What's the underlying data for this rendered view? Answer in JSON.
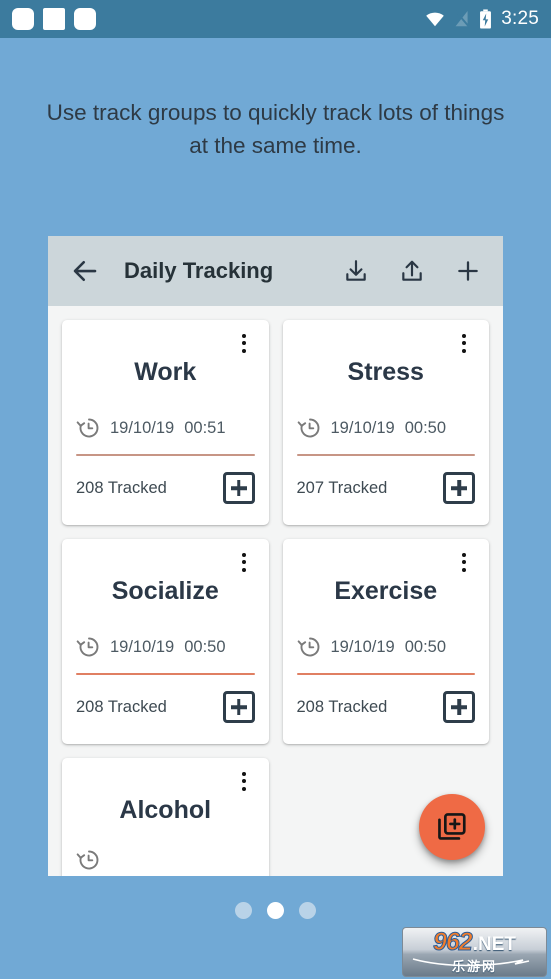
{
  "status_bar": {
    "time": "3:25",
    "icons": [
      "square-icon",
      "square-icon",
      "square-icon",
      "wifi-icon",
      "signal-off-icon",
      "battery-charging-icon"
    ]
  },
  "headline": "Use track groups to quickly track lots of things at the same time.",
  "app": {
    "title": "Daily Tracking",
    "back_icon": "arrow-back-icon",
    "actions": [
      {
        "name": "download-icon",
        "label": "Download"
      },
      {
        "name": "upload-icon",
        "label": "Upload"
      },
      {
        "name": "plus-icon",
        "label": "Add"
      }
    ],
    "fab": {
      "icon": "library-add-icon",
      "color": "#ef6a45"
    }
  },
  "cards": [
    {
      "title": "Work",
      "date": "19/10/19",
      "time": "00:51",
      "tracked": "208 Tracked",
      "divider_color": "#c79585",
      "menu_icon": "more-vert-icon",
      "history_icon": "history-icon",
      "add_icon": "add-box-icon"
    },
    {
      "title": "Stress",
      "date": "19/10/19",
      "time": "00:50",
      "tracked": "207 Tracked",
      "divider_color": "#c79585",
      "menu_icon": "more-vert-icon",
      "history_icon": "history-icon",
      "add_icon": "add-box-icon"
    },
    {
      "title": "Socialize",
      "date": "19/10/19",
      "time": "00:50",
      "tracked": "208 Tracked",
      "divider_color": "#e07f62",
      "menu_icon": "more-vert-icon",
      "history_icon": "history-icon",
      "add_icon": "add-box-icon"
    },
    {
      "title": "Exercise",
      "date": "19/10/19",
      "time": "00:50",
      "tracked": "208 Tracked",
      "divider_color": "#e07f62",
      "menu_icon": "more-vert-icon",
      "history_icon": "history-icon",
      "add_icon": "add-box-icon"
    },
    {
      "title": "Alcohol",
      "date": "",
      "time": "",
      "tracked": "",
      "divider_color": "#e07f62",
      "menu_icon": "more-vert-icon",
      "history_icon": "history-icon",
      "add_icon": "add-box-icon"
    }
  ],
  "pager": {
    "count": 3,
    "active_index": 1
  },
  "watermark": {
    "brand": "962",
    "tld": ".NET",
    "subtitle": "乐游网"
  },
  "colors": {
    "background": "#71a9d5",
    "status_bar": "#3c7b9e",
    "app_bar": "#ccd6da",
    "accent": "#ef6a45",
    "card_surface": "#ffffff",
    "text_dark": "#2b3847"
  }
}
